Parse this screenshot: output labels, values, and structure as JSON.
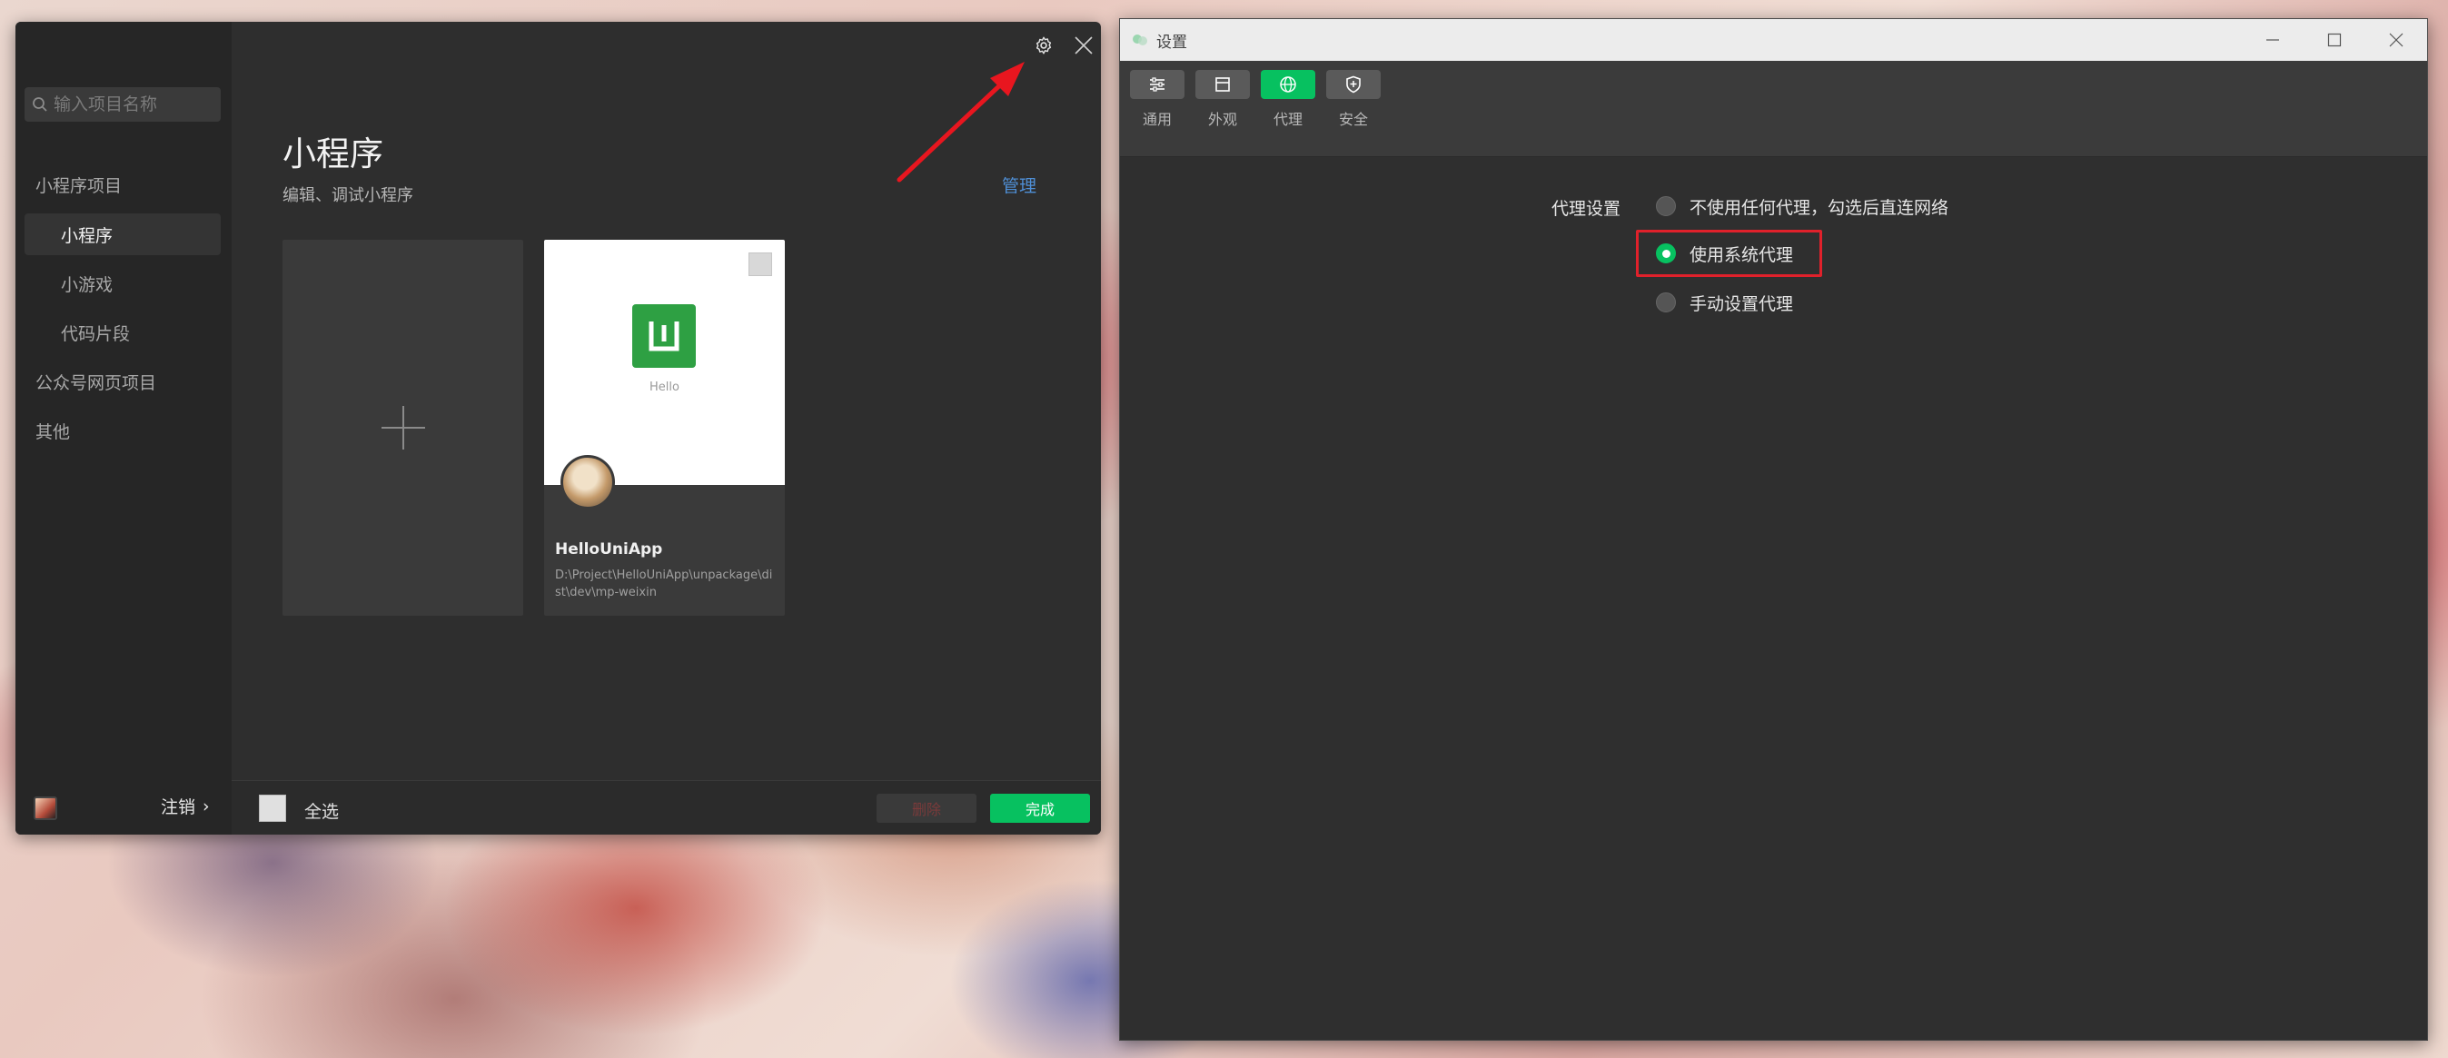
{
  "left_window": {
    "search": {
      "placeholder": "输入项目名称"
    },
    "sidebar": {
      "items": [
        {
          "label": "小程序项目"
        },
        {
          "label": "小程序"
        },
        {
          "label": "小游戏"
        },
        {
          "label": "代码片段"
        },
        {
          "label": "公众号网页项目"
        },
        {
          "label": "其他"
        }
      ],
      "logout_label": "注销",
      "logout_chevron": "›"
    },
    "header": {
      "title": "小程序",
      "subtitle": "编辑、调试小程序",
      "manage_label": "管理"
    },
    "project": {
      "name": "HelloUniApp",
      "path": "D:\\Project\\HelloUniApp\\unpackage\\dist\\dev\\mp-weixin",
      "preview_text": "Hello"
    },
    "footer": {
      "select_all_label": "全选",
      "delete_label": "删除",
      "done_label": "完成"
    }
  },
  "right_window": {
    "title": "设置",
    "tabs": [
      {
        "label": "通用",
        "icon": "sliders-icon"
      },
      {
        "label": "外观",
        "icon": "layout-icon"
      },
      {
        "label": "代理",
        "icon": "globe-icon",
        "active": true
      },
      {
        "label": "安全",
        "icon": "shield-icon"
      }
    ],
    "proxy": {
      "label": "代理设置",
      "options": [
        {
          "label": "不使用任何代理，勾选后直连网络",
          "selected": false
        },
        {
          "label": "使用系统代理",
          "selected": true
        },
        {
          "label": "手动设置代理",
          "selected": false
        }
      ]
    }
  },
  "colors": {
    "accent_green": "#07c160",
    "link_blue": "#4f8fd6",
    "annotation_red": "#e0212b"
  }
}
